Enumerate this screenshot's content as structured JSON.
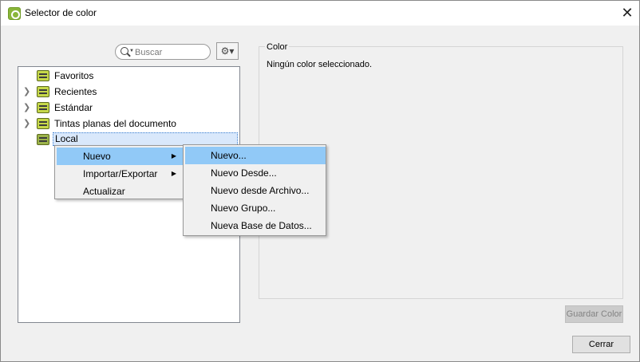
{
  "window": {
    "title": "Selector de color",
    "close_glyph": "✕"
  },
  "search": {
    "placeholder": "Buscar"
  },
  "tree": {
    "items": [
      {
        "label": "Favoritos",
        "has_arrow": false
      },
      {
        "label": "Recientes",
        "has_arrow": true
      },
      {
        "label": "Estándar",
        "has_arrow": true
      },
      {
        "label": "Tintas planas del documento",
        "has_arrow": true
      },
      {
        "label": "Local",
        "has_arrow": false,
        "selected": true
      }
    ]
  },
  "color_panel": {
    "legend": "Color",
    "status": "Ningún color seleccionado."
  },
  "buttons": {
    "save": "Guardar Color",
    "close": "Cerrar"
  },
  "context_menu": {
    "items": [
      {
        "label": "Nuevo",
        "submenu": true,
        "highlighted": true
      },
      {
        "label": "Importar/Exportar",
        "submenu": true
      },
      {
        "label": "Actualizar",
        "submenu": false
      }
    ]
  },
  "submenu": {
    "items": [
      {
        "label": "Nuevo...",
        "highlighted": true
      },
      {
        "label": "Nuevo Desde..."
      },
      {
        "label": "Nuevo desde Archivo..."
      },
      {
        "label": "Nuevo Grupo..."
      },
      {
        "label": "Nueva Base de Datos..."
      }
    ]
  },
  "icons": {
    "app": "color-selector-app-icon",
    "search": "search-icon",
    "gear": "gear-icon",
    "folder": "color-folder-icon",
    "expand": "chevron-right-icon",
    "submenu": "triangle-right-icon"
  },
  "colors": {
    "highlight": "#91c9f7",
    "selection": "#d9e8fb",
    "folder": "#c6d84a"
  }
}
